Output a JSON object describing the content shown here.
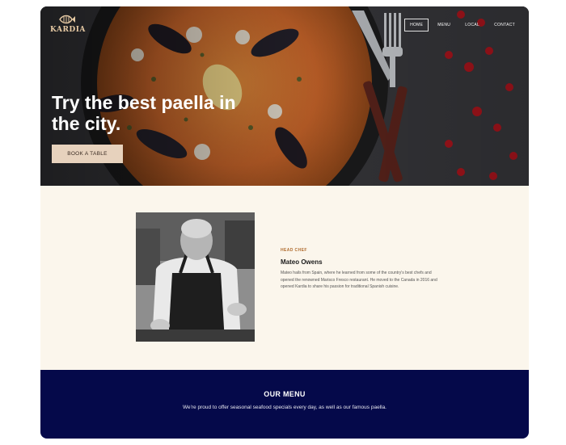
{
  "brand": {
    "name": "KARDIA",
    "logo_icon": "fish-icon"
  },
  "nav": {
    "items": [
      {
        "label": "HOME",
        "active": true
      },
      {
        "label": "MENU",
        "active": false
      },
      {
        "label": "LOCAL",
        "active": false
      },
      {
        "label": "CONTACT",
        "active": false
      }
    ]
  },
  "hero": {
    "headline": "Try the best paella in the city.",
    "cta_label": "BOOK A TABLE"
  },
  "chef": {
    "eyebrow": "HEAD CHEF",
    "name": "Mateo Owens",
    "bio": "Mateo hails from Spain, where he learned from some of the country's best chefs and opened the renowned Marisco Fresco restaurant. He moved to the Canada in 2016 and opened Kardia to share his passion for traditional Spanish cuisine."
  },
  "menu_section": {
    "title": "OUR MENU",
    "text": "We're proud to offer seasonal seafood specials every day, as well as our famous paella."
  },
  "colors": {
    "cream": "#fbf6ec",
    "navy": "#05094a",
    "accent": "#e7d2bd",
    "eyebrow": "#b06c2e"
  }
}
